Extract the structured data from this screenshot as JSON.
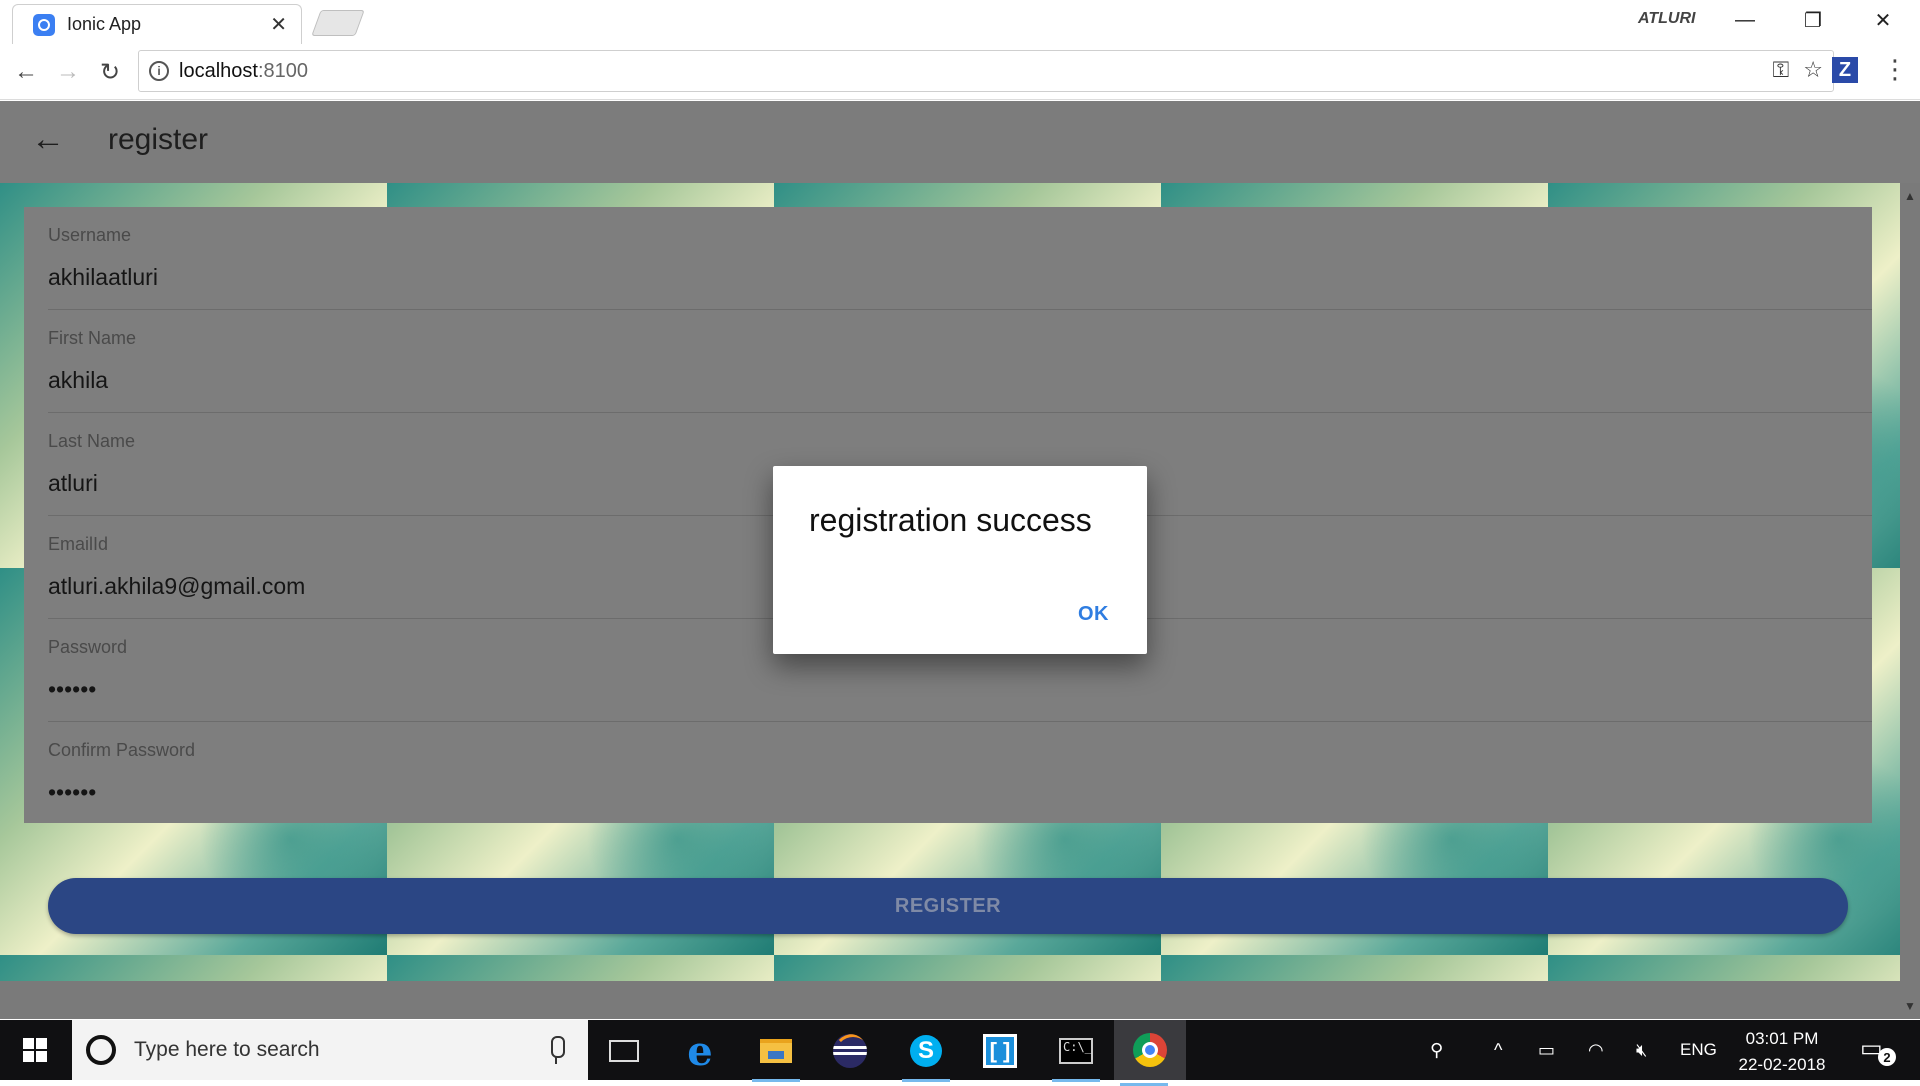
{
  "browser": {
    "tab_title": "Ionic App",
    "tab_close": "✕",
    "user_label": "ATLURI",
    "window_buttons": {
      "minimize": "—",
      "restore": "❐",
      "close": "✕"
    },
    "nav": {
      "back": "←",
      "forward": "→",
      "reload": "↻"
    },
    "url_host": "localhost",
    "url_port": ":8100",
    "info_icon": "i",
    "key_icon": "⚿",
    "star_icon": "☆",
    "extension_label": "Z",
    "menu_icon": "⋮"
  },
  "app": {
    "back_icon": "←",
    "title": "register",
    "fields": [
      {
        "label": "Username",
        "value": "akhilaatluri"
      },
      {
        "label": "First Name",
        "value": "akhila"
      },
      {
        "label": "Last Name",
        "value": "atluri"
      },
      {
        "label": "EmailId",
        "value": "atluri.akhila9@gmail.com"
      },
      {
        "label": "Password",
        "value": "••••••"
      },
      {
        "label": "Confirm Password",
        "value": "••••••"
      }
    ],
    "register_label": "REGISTER",
    "dialog": {
      "title": "registration success",
      "ok_label": "OK"
    }
  },
  "taskbar": {
    "search_placeholder": "Type here to search",
    "edge_label": "e",
    "skype_label": "S",
    "bracket_label": "[ ]",
    "cmd_label": "C:\\_",
    "tray": {
      "people": "⚲",
      "chevron": "^",
      "battery": "▭",
      "wifi": "◠",
      "volume": "🔇︎",
      "language": "ENG"
    },
    "clock_time": "03:01 PM",
    "clock_date": "22-02-2018",
    "notification_icon": "▭",
    "notification_count": "2"
  },
  "colors": {
    "app_header": "#7c7c7c",
    "register_button": "#2b4684",
    "dialog_ok": "#2f7de1",
    "taskbar": "#101012"
  }
}
